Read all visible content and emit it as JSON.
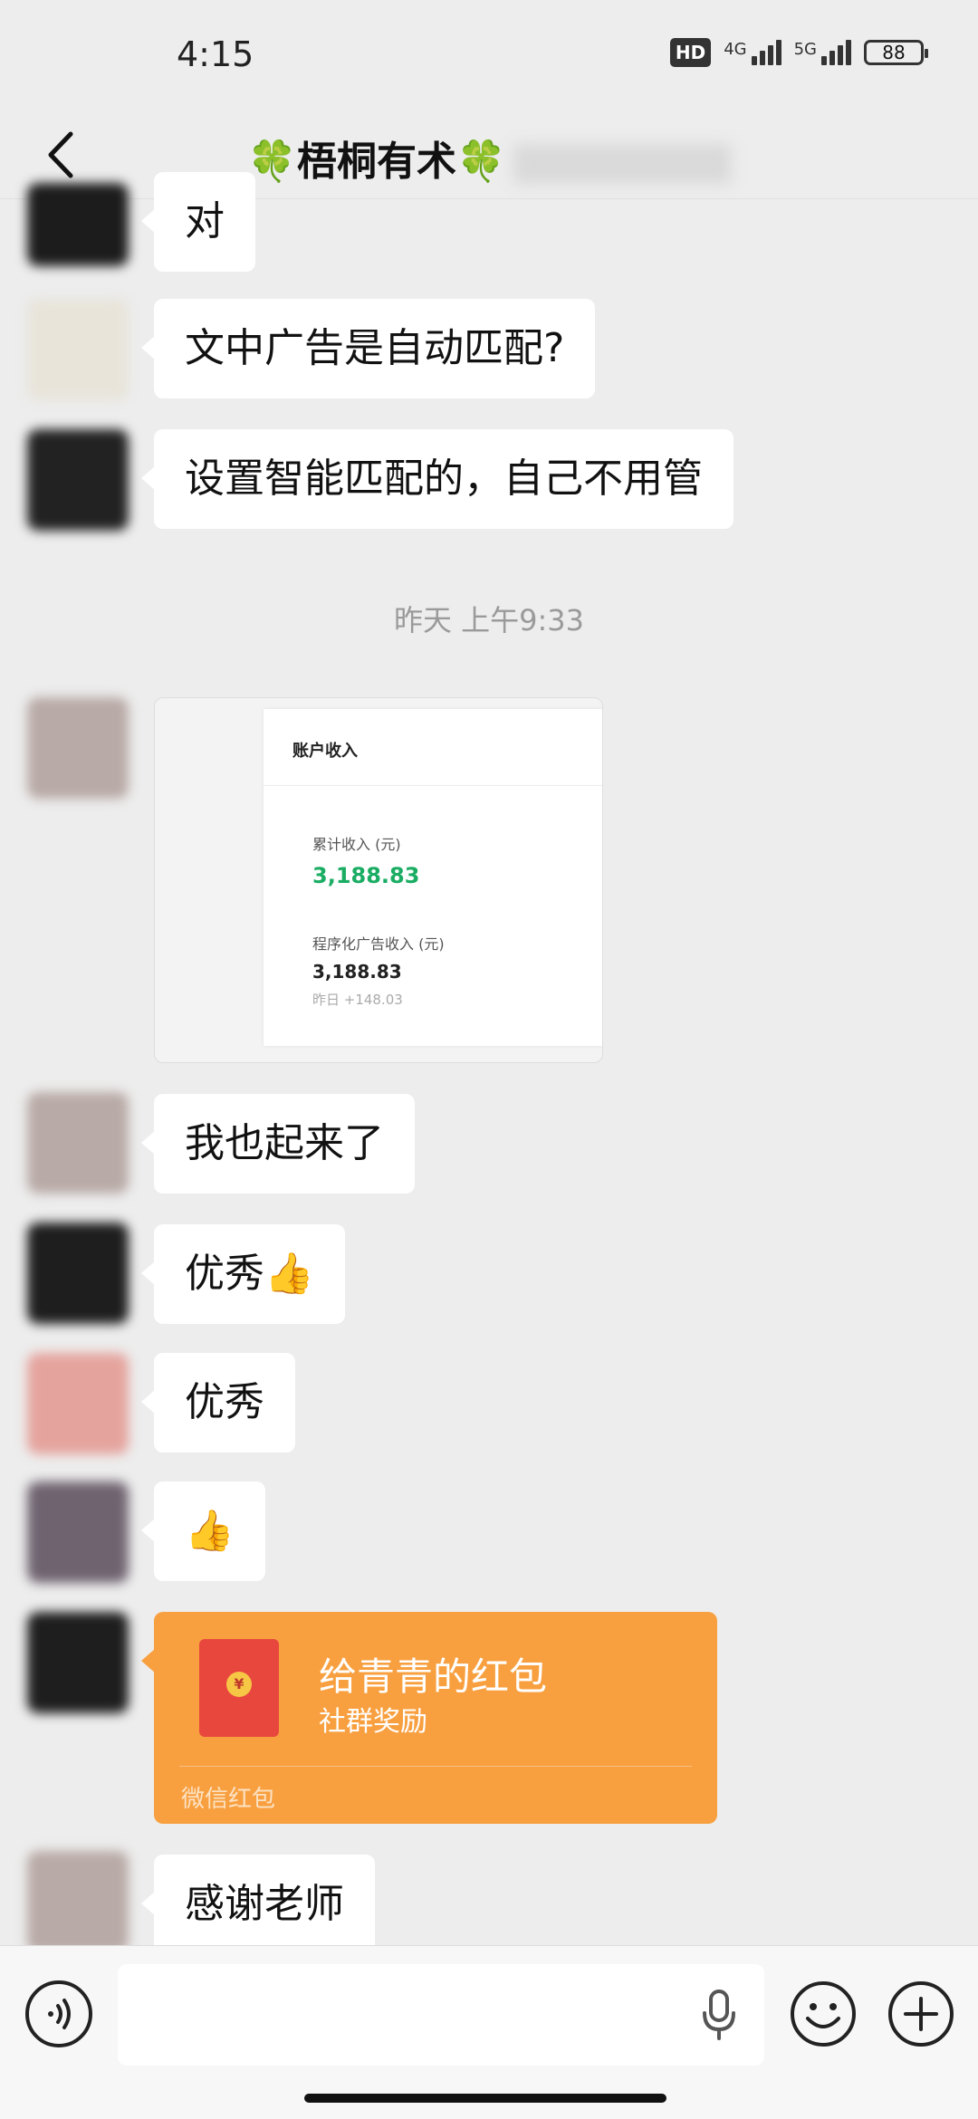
{
  "status_bar": {
    "time": "4:15",
    "hd": "HD",
    "net1": "4G",
    "net2": "5G",
    "battery": "88"
  },
  "header": {
    "title": "🍀梧桐有术🍀"
  },
  "messages": [
    {
      "text": "对"
    },
    {
      "text": "文中广告是自动匹配?"
    },
    {
      "text": "设置智能匹配的，自己不用管"
    },
    {
      "text": "我也起来了"
    },
    {
      "text": "优秀👍"
    },
    {
      "text": "优秀"
    },
    {
      "text": "👍"
    },
    {
      "text": "感谢老师"
    }
  ],
  "timestamp": "昨天 上午9:33",
  "image_card": {
    "title": "账户收入",
    "label1": "累计收入 (元)",
    "value1": "3,188.83",
    "label2": "程序化广告收入 (元)",
    "value2": "3,188.83",
    "delta": "昨日 +148.03"
  },
  "red_packet": {
    "title": "给青青的红包",
    "subtitle": "社群奖励",
    "footer": "微信红包",
    "coin": "¥"
  },
  "input_bar": {
    "placeholder": ""
  },
  "colors": {
    "background": "#ededed",
    "bubble": "#ffffff",
    "packet": "#f8a040",
    "income_green": "#1aad63"
  }
}
